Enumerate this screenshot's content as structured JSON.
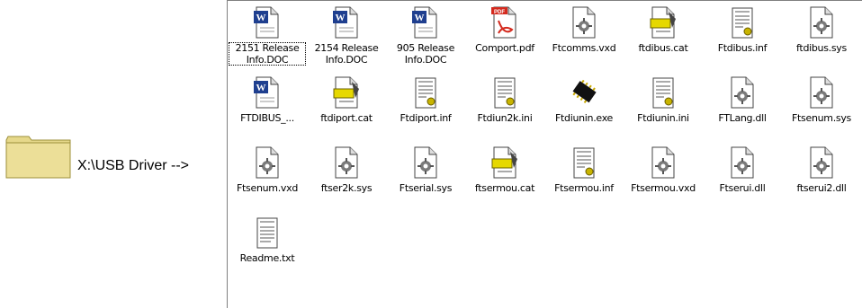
{
  "folder": {
    "label": "X:\\USB Driver -->",
    "icon": "folder-icon"
  },
  "files": [
    {
      "name": "2151 Release\nInfo.DOC",
      "icon": "word-doc-icon",
      "selected": true
    },
    {
      "name": "2154 Release\nInfo.DOC",
      "icon": "word-doc-icon"
    },
    {
      "name": "905 Release\nInfo.DOC",
      "icon": "word-doc-icon"
    },
    {
      "name": "Comport.pdf",
      "icon": "pdf-icon"
    },
    {
      "name": "Ftcomms.vxd",
      "icon": "system-file-icon"
    },
    {
      "name": "ftdibus.cat",
      "icon": "security-catalog-icon"
    },
    {
      "name": "Ftdibus.inf",
      "icon": "setup-info-icon"
    },
    {
      "name": "ftdibus.sys",
      "icon": "system-file-icon"
    },
    {
      "name": "FTDIBUS_...",
      "icon": "word-doc-icon"
    },
    {
      "name": "ftdiport.cat",
      "icon": "security-catalog-icon"
    },
    {
      "name": "Ftdiport.inf",
      "icon": "setup-info-icon"
    },
    {
      "name": "Ftdiun2k.ini",
      "icon": "setup-info-icon"
    },
    {
      "name": "Ftdiunin.exe",
      "icon": "chip-exe-icon"
    },
    {
      "name": "Ftdiunin.ini",
      "icon": "setup-info-icon"
    },
    {
      "name": "FTLang.dll",
      "icon": "system-file-icon"
    },
    {
      "name": "Ftsenum.sys",
      "icon": "system-file-icon"
    },
    {
      "name": "Ftsenum.vxd",
      "icon": "system-file-icon"
    },
    {
      "name": "ftser2k.sys",
      "icon": "system-file-icon"
    },
    {
      "name": "Ftserial.sys",
      "icon": "system-file-icon"
    },
    {
      "name": "ftsermou.cat",
      "icon": "security-catalog-icon"
    },
    {
      "name": "Ftsermou.inf",
      "icon": "setup-info-icon"
    },
    {
      "name": "Ftsermou.vxd",
      "icon": "system-file-icon"
    },
    {
      "name": "Ftserui.dll",
      "icon": "system-file-icon"
    },
    {
      "name": "ftserui2.dll",
      "icon": "system-file-icon"
    },
    {
      "name": "Readme.txt",
      "icon": "text-doc-icon"
    }
  ],
  "colors": {
    "folder_body": "#e6d88a",
    "folder_edge": "#9c8f3a",
    "word_blue": "#1f3f8f",
    "pdf_red": "#d42a1e",
    "catalog_yellow": "#e6d800",
    "gear_gray": "#7a7a7a"
  }
}
